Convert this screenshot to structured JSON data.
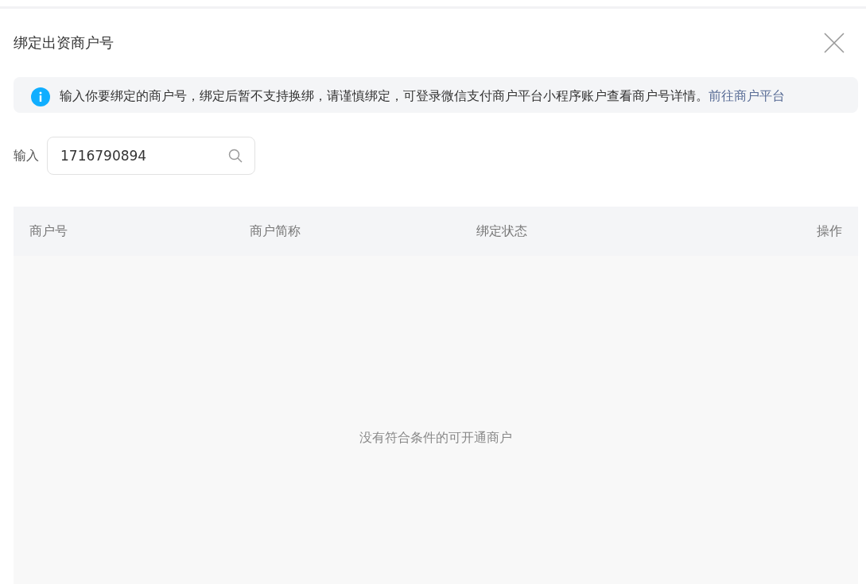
{
  "dialog": {
    "title": "绑定出资商户号"
  },
  "notice": {
    "text": "输入你要绑定的商户号，绑定后暂不支持换绑，请谨慎绑定，可登录微信支付商户平台小程序账户查看商户号详情。",
    "link": "前往商户平台"
  },
  "search": {
    "label": "输入",
    "value": "1716790894"
  },
  "table": {
    "columns": [
      "商户号",
      "商户简称",
      "绑定状态",
      "操作"
    ],
    "empty_text": "没有符合条件的可开通商户"
  }
}
